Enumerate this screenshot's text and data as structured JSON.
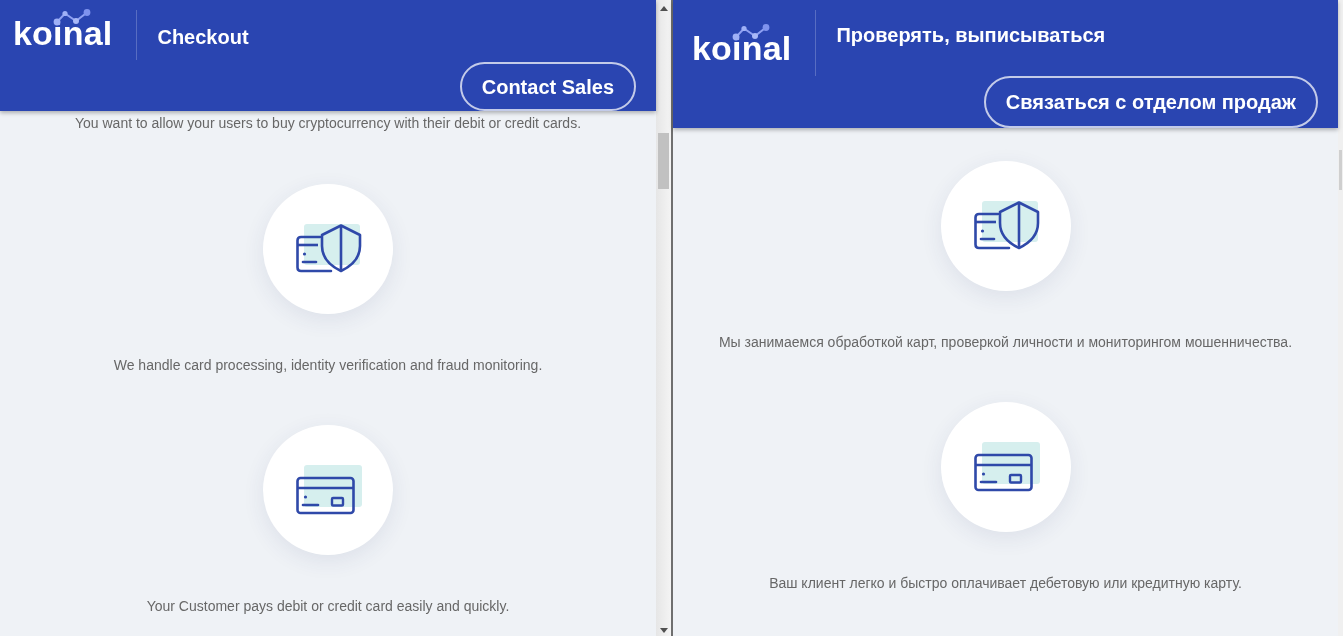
{
  "panes": [
    {
      "header": {
        "logo": "koinal",
        "title": "Checkout",
        "button": "Contact Sales"
      },
      "intro": "You want to allow your users to buy cryptocurrency with their debit or credit cards.",
      "features": [
        {
          "kind": "card-shield",
          "text": "We handle card processing, identity verification and fraud monitoring."
        },
        {
          "kind": "card",
          "text": "Your Customer pays debit or credit card easily and quickly."
        }
      ]
    },
    {
      "header": {
        "logo": "koinal",
        "title": "Проверять, выписываться",
        "button": "Связаться с отделом продаж"
      },
      "features": [
        {
          "kind": "card-shield",
          "text": "Мы занимаемся обработкой карт, проверкой личности и мониторингом мошенничества."
        },
        {
          "kind": "card",
          "text": "Ваш клиент легко и быстро оплачивает дебетовую или кредитную карту."
        }
      ]
    }
  ]
}
